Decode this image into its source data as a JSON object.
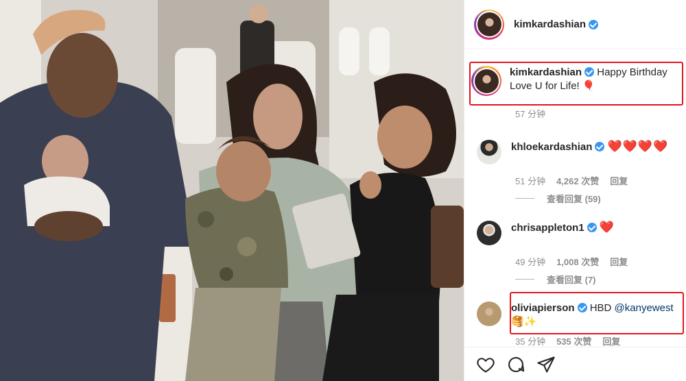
{
  "post": {
    "author": "kimkardashian",
    "verified": true
  },
  "caption": {
    "username": "kimkardashian",
    "text": "Happy Birthday Love U for Life!",
    "emoji": "🎈",
    "time": "57 分钟"
  },
  "comments": [
    {
      "username": "khloekardashian",
      "text": "❤️❤️❤️❤️",
      "time": "51 分钟",
      "likes": "4,262 次赞",
      "reply": "回复",
      "view_replies": "查看回复 (59)"
    },
    {
      "username": "chrisappleton1",
      "text": "❤️",
      "time": "49 分钟",
      "likes": "1,008 次赞",
      "reply": "回复",
      "view_replies": "查看回复 (7)"
    },
    {
      "username": "oliviapierson",
      "text_prefix": "HBD",
      "mention": "@kanyewest",
      "emoji_line": "🥞✨",
      "time": "35 分钟",
      "likes": "535 次赞",
      "reply": "回复"
    }
  ],
  "actions": {
    "like_icon": "heart-outline-icon",
    "comment_icon": "comment-bubble-icon",
    "share_icon": "paper-plane-icon"
  },
  "colors": {
    "verified": "#3897f0",
    "highlight_box": "#e3141c",
    "heart": "#ed4956",
    "mention": "#00376b"
  }
}
